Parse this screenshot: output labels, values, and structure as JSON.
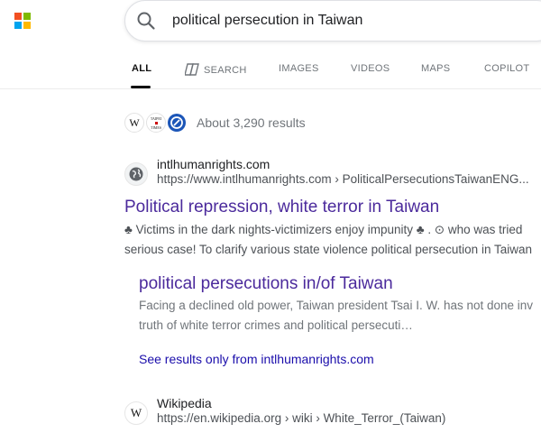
{
  "brand": {
    "colors": [
      "#f25022",
      "#7fba00",
      "#00a4ef",
      "#ffb900"
    ]
  },
  "search": {
    "query": "political persecution in Taiwan",
    "icon": "search-icon"
  },
  "tabs": [
    {
      "label": "ALL",
      "active": true
    },
    {
      "label": "SEARCH",
      "icon": "copilot-search-icon"
    },
    {
      "label": "IMAGES"
    },
    {
      "label": "VIDEOS"
    },
    {
      "label": "MAPS"
    },
    {
      "label": "COPILOT"
    }
  ],
  "summary": {
    "favicons": [
      {
        "name": "wikipedia-favicon",
        "glyph": "W"
      },
      {
        "name": "taipei-times-favicon",
        "lines": [
          "TAIPEI",
          "TIMES"
        ]
      },
      {
        "name": "circle-logo-favicon"
      }
    ],
    "count_text": "About 3,290 results"
  },
  "results": [
    {
      "site_name": "intlhumanrights.com",
      "site_url": "https://www.intlhumanrights.com › PoliticalPersecutionsTaiwanENG...",
      "title": "Political repression, white terror in Taiwan",
      "snippet_line1": "♣ Victims in the dark nights-victimizers enjoy impunity ♣ . ⊙ who was tried",
      "snippet_line2": "serious case! To clarify various state violence political persecution in Taiwan",
      "sublink": {
        "title": "political persecutions in/of Taiwan",
        "snippet_line1": "Facing a declined old power, Taiwan president Tsai I. W. has not done inv",
        "snippet_line2": "truth of white terror crimes and political persecuti…"
      },
      "see_more": "See results only from intlhumanrights.com"
    },
    {
      "site_name": "Wikipedia",
      "site_url": "https://en.wikipedia.org › wiki › White_Terror_(Taiwan)",
      "site_glyph": "W"
    }
  ]
}
